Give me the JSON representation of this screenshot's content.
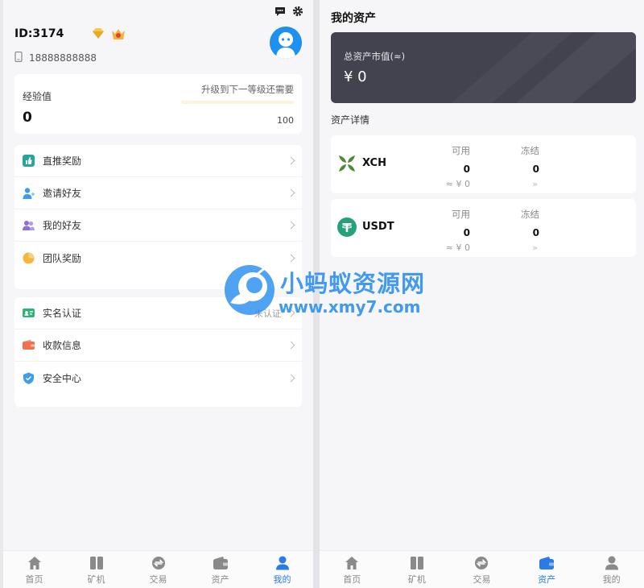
{
  "profile": {
    "user_id": "ID:3174",
    "phone": "18888888888",
    "experience_label": "经验值",
    "experience_value": "0",
    "next_level_hint": "升级到下一等级还需要",
    "next_level_value": "100",
    "progress": 0
  },
  "menu_group_1": [
    {
      "label": "直推奖励",
      "icon": "thumbs-up-icon",
      "color": "#26a69a"
    },
    {
      "label": "邀请好友",
      "icon": "add-user-icon",
      "color": "#3d9bf0"
    },
    {
      "label": "我的好友",
      "icon": "friends-icon",
      "color": "#8e6fd6"
    },
    {
      "label": "团队奖励",
      "icon": "pie-chart-icon",
      "color": "#f4b63f"
    }
  ],
  "menu_group_2": [
    {
      "label": "实名认证",
      "icon": "id-card-icon",
      "color": "#2fb37a",
      "status": "未认证"
    },
    {
      "label": "收款信息",
      "icon": "wallet-icon",
      "color": "#f0704f"
    },
    {
      "label": "安全中心",
      "icon": "shield-icon",
      "color": "#3d9bf0"
    }
  ],
  "tabs": [
    {
      "label": "首页",
      "icon": "home-icon"
    },
    {
      "label": "矿机",
      "icon": "miner-icon"
    },
    {
      "label": "交易",
      "icon": "exchange-icon"
    },
    {
      "label": "资产",
      "icon": "wallet-icon"
    },
    {
      "label": "我的",
      "icon": "user-icon"
    }
  ],
  "left_active_tab": 4,
  "right_active_tab": 3,
  "assets": {
    "title": "我的资产",
    "total_label": "总资产市值(≈)",
    "total_value": "¥ 0",
    "section_title": "资产详情",
    "available_label": "可用",
    "frozen_label": "冻结",
    "list": [
      {
        "name": "XCH",
        "available": "0",
        "frozen": "0",
        "approx": "≈ ¥ 0",
        "icon": "chia-icon"
      },
      {
        "name": "USDT",
        "available": "0",
        "frozen": "0",
        "approx": "≈ ¥ 0",
        "icon": "tether-icon"
      }
    ]
  },
  "watermark": {
    "title": "小蚂蚁资源网",
    "url": "www.xmy7.com"
  },
  "colors": {
    "accent": "#2a7be8",
    "avatar": "#1e90f0",
    "total_card": "#43434f",
    "exp_bar": "#f3c04b"
  }
}
